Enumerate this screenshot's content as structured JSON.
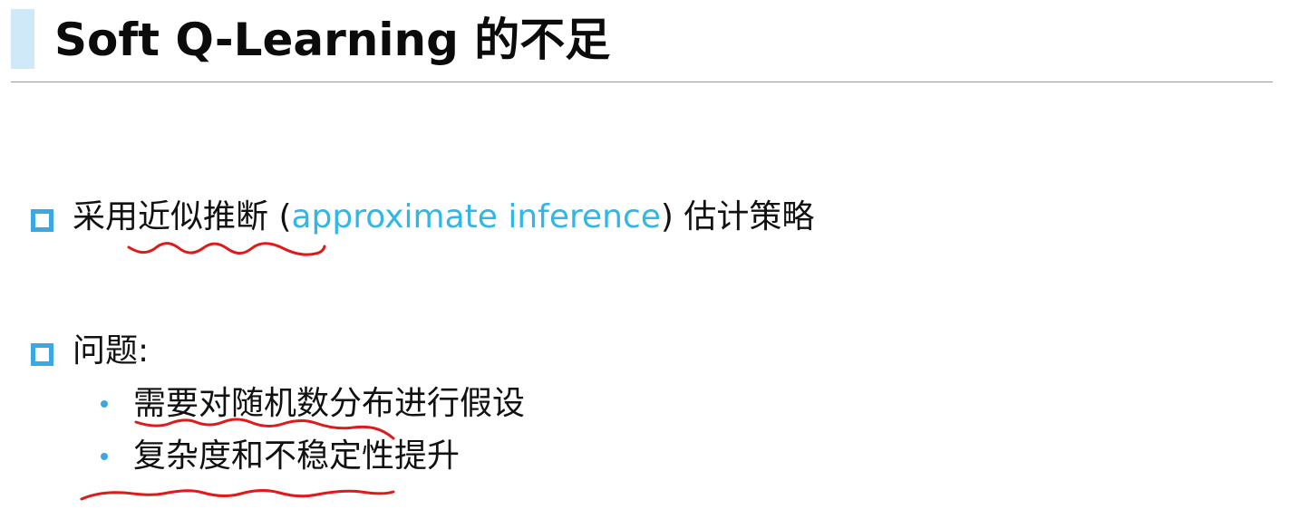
{
  "slide": {
    "title": "Soft Q-Learning 的不足",
    "bullets": [
      {
        "prefix": "采用近似推断 (",
        "highlight": "approximate inference",
        "suffix": ") 估计策略"
      },
      {
        "text": "问题:",
        "sub_items": [
          "需要对随机数分布进行假设",
          "复杂度和不稳定性提升"
        ]
      }
    ]
  },
  "colors": {
    "accent_blue": "#3ba7e3",
    "highlight_text": "#31b6e8",
    "title_bar": "#cfe9f8",
    "annotation_red": "#e0191b"
  }
}
